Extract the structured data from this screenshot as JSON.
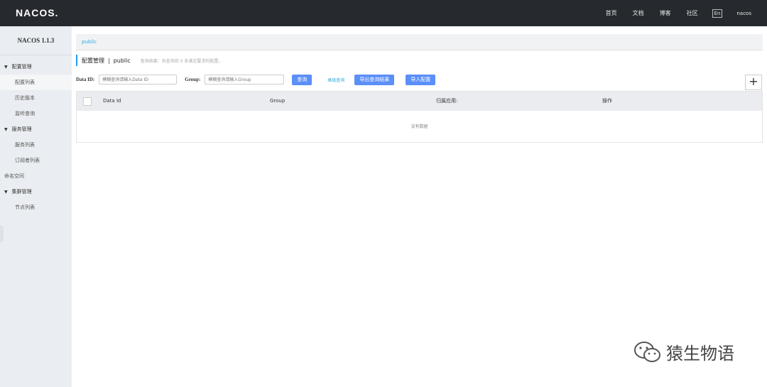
{
  "header": {
    "logo": "NACOS.",
    "nav": [
      "首页",
      "文档",
      "博客",
      "社区"
    ],
    "lang": "En",
    "user": "nacos"
  },
  "sidebar": {
    "version": "NACOS 1.1.3",
    "groups": [
      {
        "label": "配置管理",
        "items": [
          "配置列表",
          "历史版本",
          "监听查询"
        ]
      },
      {
        "label": "服务管理",
        "items": [
          "服务列表",
          "订阅者列表"
        ]
      },
      {
        "label": "命名空间"
      },
      {
        "label": "集群管理",
        "items": [
          "节点列表"
        ]
      }
    ]
  },
  "breadcrumb": "public",
  "heading": {
    "title": "配置管理",
    "separator": "|",
    "namespace": "public",
    "hint": "查询结果：共查询到 0 条满足要求的配置。"
  },
  "search": {
    "dataid_label": "Data ID:",
    "dataid_placeholder": "模糊查询请输入Data ID",
    "group_label": "Group:",
    "group_placeholder": "模糊查询请输入Group",
    "query_button": "查询",
    "advanced_link": "高级查询",
    "export_button": "导出查询结果",
    "import_button": "导入配置"
  },
  "table": {
    "columns": [
      "Data Id",
      "Group",
      "归属应用:",
      "操作"
    ],
    "empty_text": "没有数据"
  },
  "watermark": "猿生物语",
  "colors": {
    "primary": "#5b8ff9",
    "topbar": "#262a2e",
    "link": "#33aadd"
  }
}
